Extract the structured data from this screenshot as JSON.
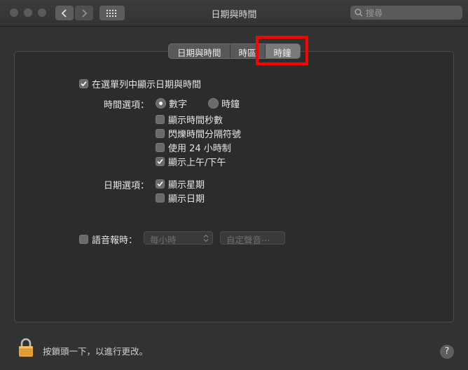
{
  "window": {
    "title": "日期與時間"
  },
  "search": {
    "placeholder": "搜尋"
  },
  "tabs": [
    {
      "label": "日期與時間"
    },
    {
      "label": "時區"
    },
    {
      "label": "時鐘",
      "selected": true
    }
  ],
  "menubar_option": {
    "label": "在選單列中顯示日期與時間",
    "checked": true
  },
  "time_options": {
    "label": "時間選項：",
    "digital": {
      "label": "數字",
      "selected": true
    },
    "analog": {
      "label": "時鐘",
      "selected": false
    },
    "show_seconds": {
      "label": "顯示時間秒數",
      "checked": false
    },
    "flash_separators": {
      "label": "閃爍時間分隔符號",
      "checked": false
    },
    "use_24h": {
      "label": "使用 24 小時制",
      "checked": false
    },
    "show_ampm": {
      "label": "顯示上午/下午",
      "checked": true
    }
  },
  "date_options": {
    "label": "日期選項：",
    "show_weekday": {
      "label": "顯示星期",
      "checked": true
    },
    "show_date": {
      "label": "顯示日期",
      "checked": false
    }
  },
  "announce": {
    "label": "語音報時：",
    "checked": false,
    "interval": "每小時",
    "voice_button": "自定聲音⋯"
  },
  "footer": {
    "lock_text": "按鎖頭一下，以進行更改。",
    "help": "?"
  },
  "colors": {
    "highlight_box": "#ff0000",
    "background": "#323232"
  }
}
